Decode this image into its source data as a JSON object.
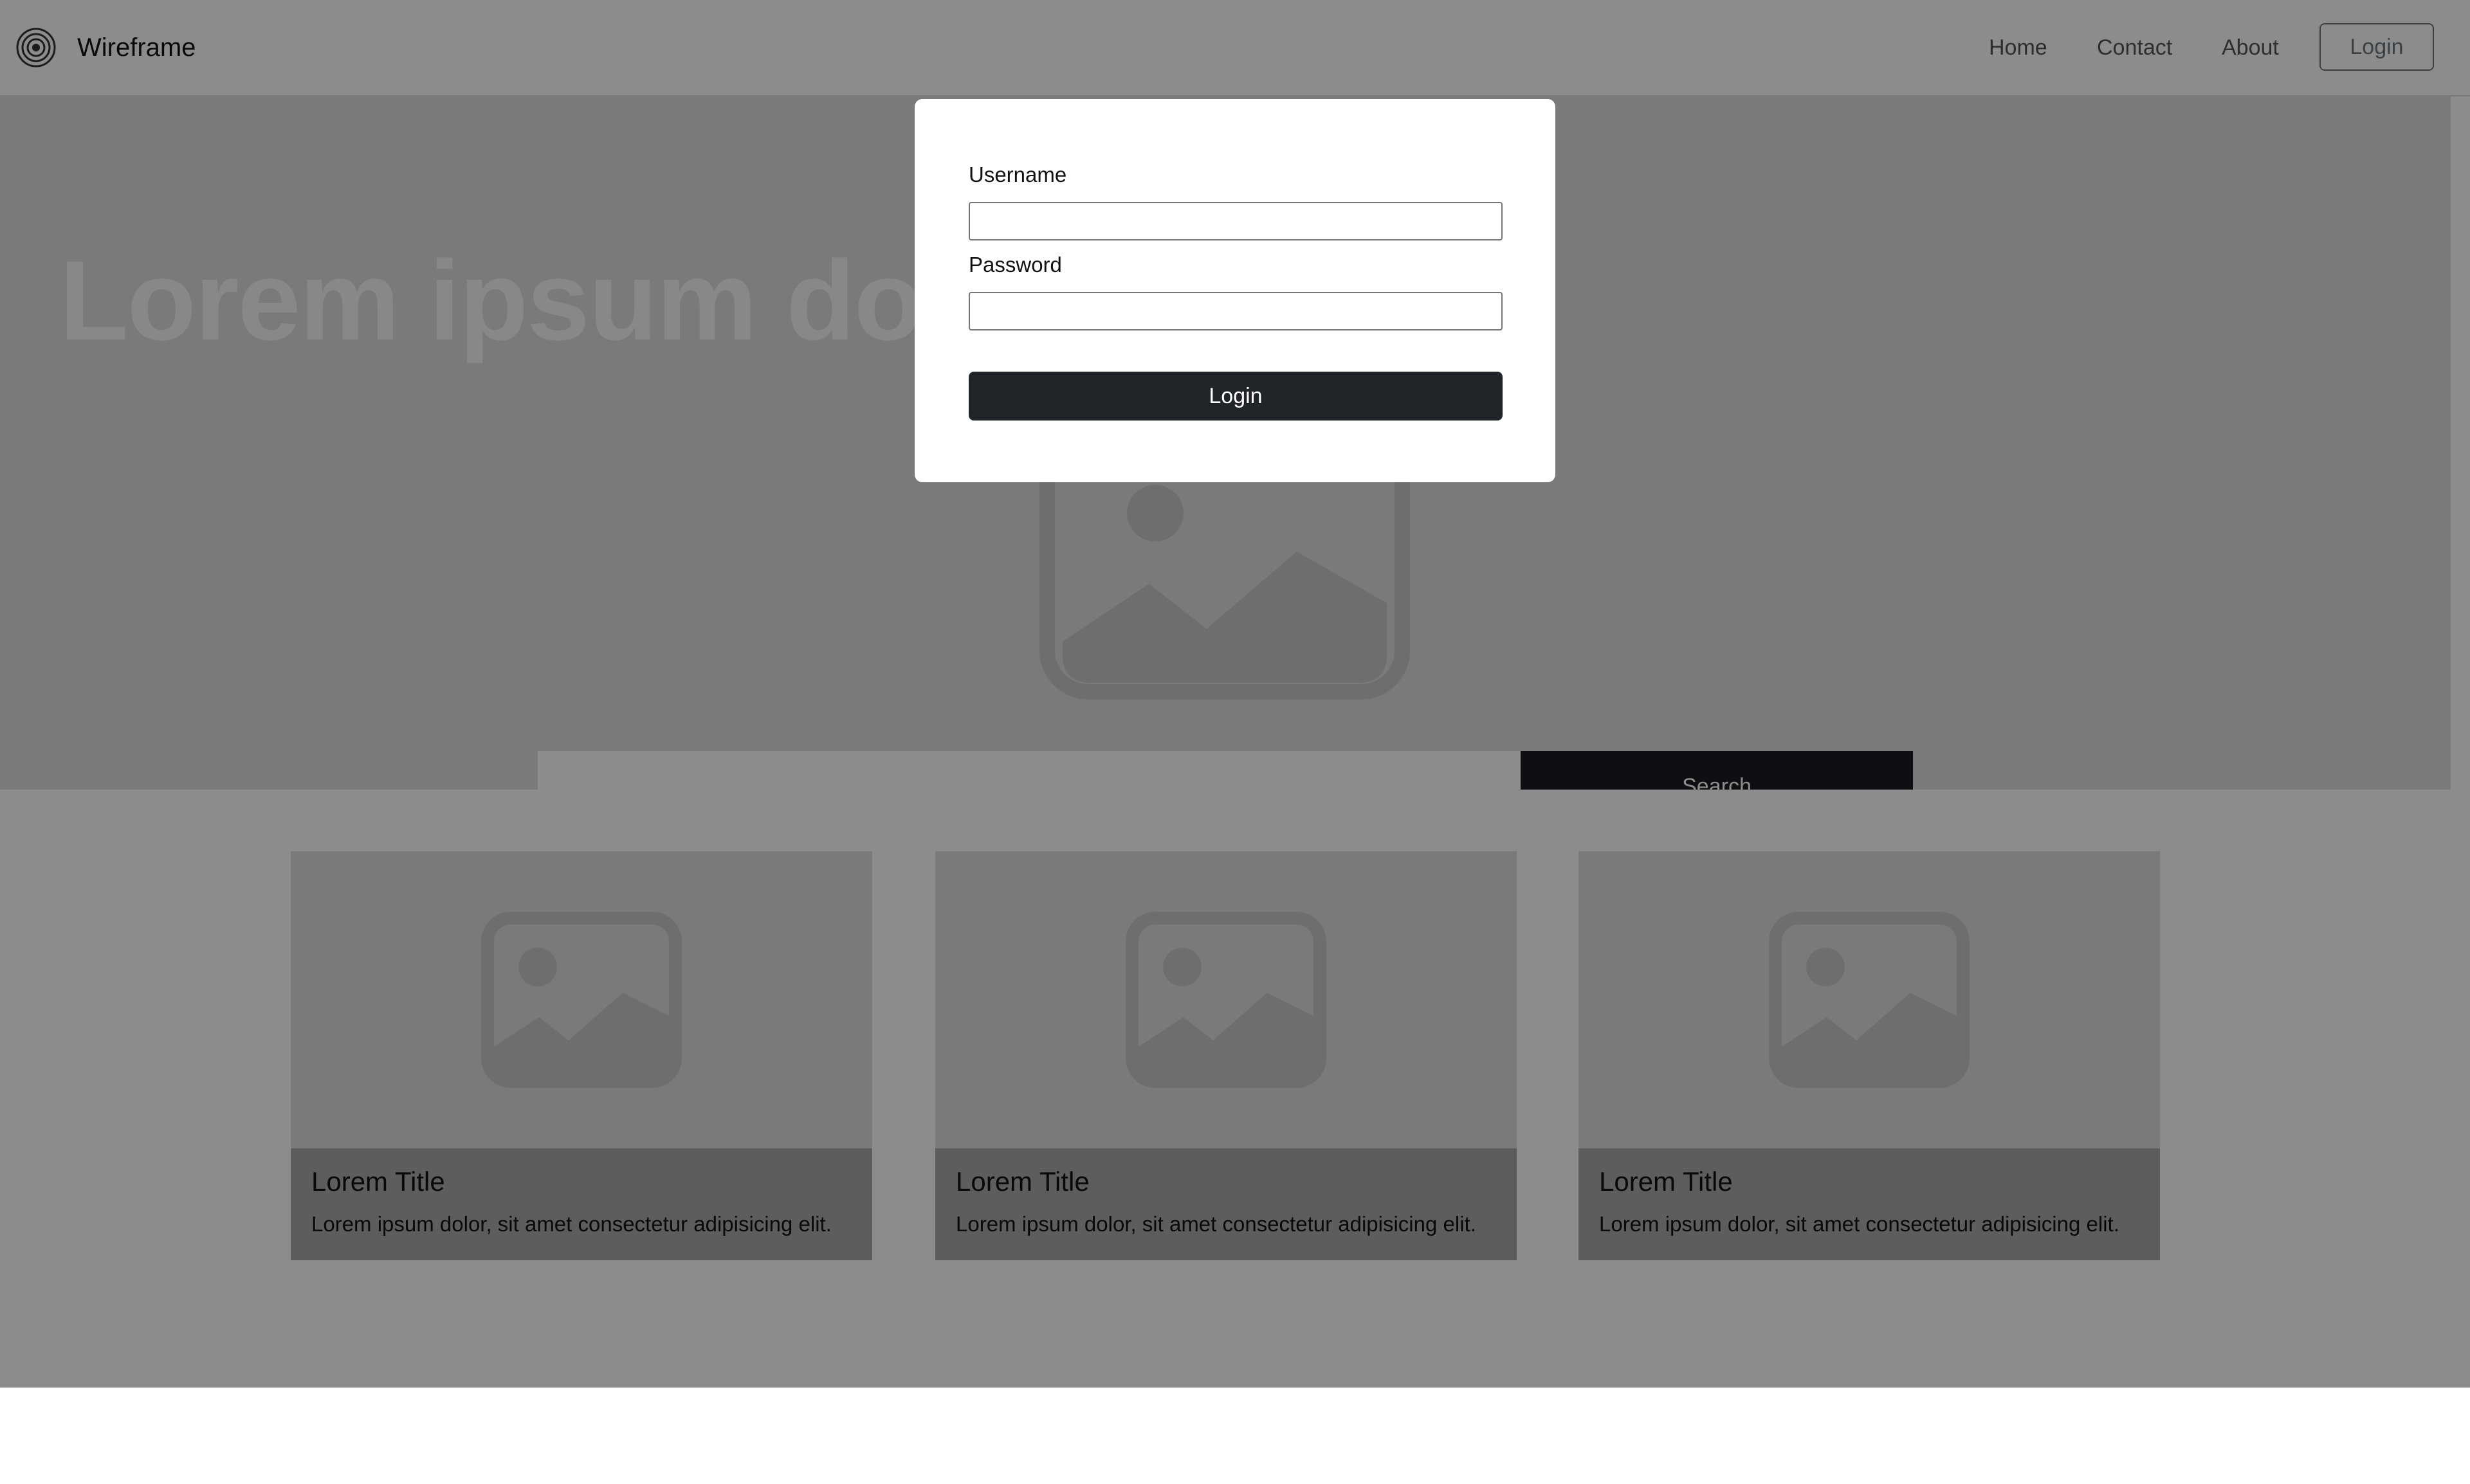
{
  "navbar": {
    "brand": "Wireframe",
    "links": [
      "Home",
      "Contact",
      "About"
    ],
    "login_label": "Login"
  },
  "hero": {
    "title": "Lorem ipsum dolor sit amet",
    "search_placeholder": "",
    "search_label": "Search"
  },
  "cards": [
    {
      "title": "Lorem Title",
      "text": "Lorem ipsum dolor, sit amet consectetur adipisicing elit."
    },
    {
      "title": "Lorem Title",
      "text": "Lorem ipsum dolor, sit amet consectetur adipisicing elit."
    },
    {
      "title": "Lorem Title",
      "text": "Lorem ipsum dolor, sit amet consectetur adipisicing elit."
    }
  ],
  "modal": {
    "username_label": "Username",
    "username_value": "",
    "password_label": "Password",
    "password_value": "",
    "submit_label": "Login"
  },
  "icons": {
    "brand": "target-logo-icon",
    "placeholder": "image-placeholder-icon"
  }
}
